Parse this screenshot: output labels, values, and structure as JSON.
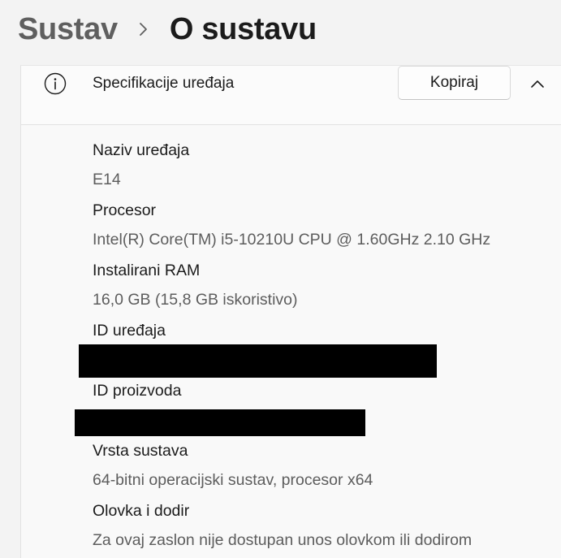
{
  "breadcrumb": {
    "parent": "Sustav",
    "current": "O sustavu",
    "separator_icon": "chevron-right-icon"
  },
  "card": {
    "icon": "info-icon",
    "title": "Specifikacije uređaja",
    "copy_label": "Kopiraj",
    "collapse_icon": "chevron-up-icon"
  },
  "specs": [
    {
      "label": "Naziv uređaja",
      "value": "E14"
    },
    {
      "label": "Procesor",
      "value": "Intel(R) Core(TM) i5-10210U CPU @ 1.60GHz   2.10 GHz"
    },
    {
      "label": "Instalirani RAM",
      "value": "16,0 GB (15,8 GB iskoristivo)"
    },
    {
      "label": "ID uređaja",
      "value": "",
      "redacted": true
    },
    {
      "label": "ID proizvoda",
      "value": "",
      "redacted": true
    },
    {
      "label": "Vrsta sustava",
      "value": "64-bitni operacijski sustav, procesor x64"
    },
    {
      "label": "Olovka i dodir",
      "value": "Za ovaj zaslon nije dostupan unos olovkom ili dodirom"
    }
  ],
  "colors": {
    "background": "#f3f3f3",
    "card": "#f9f9f9",
    "label": "#1b1b1b",
    "value": "#5d5d5d",
    "redaction": "#000000"
  }
}
